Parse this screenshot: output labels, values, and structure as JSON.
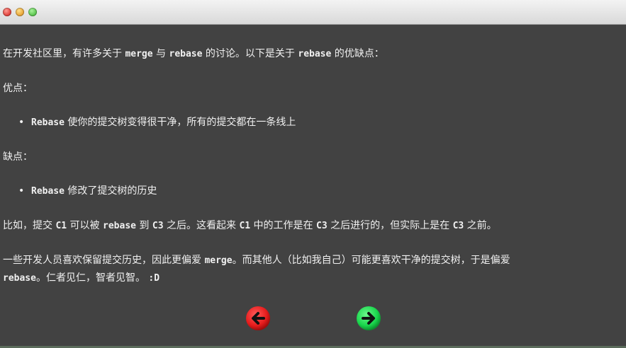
{
  "window": {
    "controls": [
      "close",
      "minimize",
      "maximize"
    ]
  },
  "content": {
    "intro": {
      "before_merge": "在开发社区里，有许多关于 ",
      "merge": "merge",
      "between": " 与 ",
      "rebase": "rebase",
      "mid": " 的讨论。以下是关于 ",
      "rebase2": "rebase",
      "after": " 的优缺点："
    },
    "pros_heading": "优点：",
    "pros": [
      {
        "code": "Rebase",
        "text": " 使你的提交树变得很干净，所有的提交都在一条线上"
      }
    ],
    "cons_heading": "缺点：",
    "cons": [
      {
        "code": "Rebase",
        "text": " 修改了提交树的历史"
      }
    ],
    "example": {
      "p1": "比如，提交 ",
      "c1": "C1",
      "p2": " 可以被 ",
      "rebase": "rebase",
      "p3": " 到 ",
      "c3": "C3",
      "p4": " 之后。这看起来 ",
      "c1b": "C1",
      "p5": " 中的工作是在 ",
      "c3b": "C3",
      "p6": " 之后进行的，但实际上是在 ",
      "c3c": "C3",
      "p7": " 之前。"
    },
    "opinion": {
      "p1": "一些开发人员喜欢保留提交历史，因此更偏爱 ",
      "merge": "merge",
      "p2": "。而其他人（比如我自己）可能更喜欢干净的提交树，于是偏爱",
      "rebase": "rebase",
      "p3": "。仁者见仁，智者见智。 ",
      "smile": ":D"
    }
  },
  "nav": {
    "prev_icon": "arrow-left-icon",
    "next_icon": "arrow-right-icon",
    "prev_color": "#e51c1c",
    "next_color": "#19d64c"
  }
}
